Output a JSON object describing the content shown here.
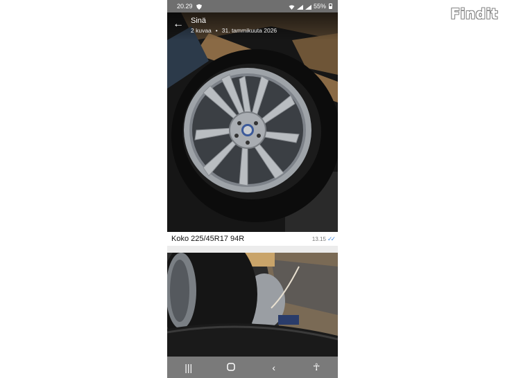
{
  "watermark": "Findit",
  "status_bar": {
    "time": "20.29",
    "battery": "55%"
  },
  "header": {
    "sender": "Sinä",
    "photo_count": "2 kuvaa",
    "date": "31. tammikuuta 2026"
  },
  "message": {
    "caption": "Koko 225/45R17 94R",
    "time": "13.15"
  },
  "icons": [
    "back-arrow-icon",
    "double-check-icon",
    "recents-icon",
    "home-icon",
    "back-icon",
    "accessibility-icon"
  ],
  "nav": {
    "recents_glyph": "|||",
    "back_glyph": "‹",
    "accessibility_glyph": "☥"
  },
  "colors": {
    "read_ticks": "#4a8fe0",
    "status_bar": "#6f6f6f",
    "nav_bar": "#7a7a7a"
  }
}
